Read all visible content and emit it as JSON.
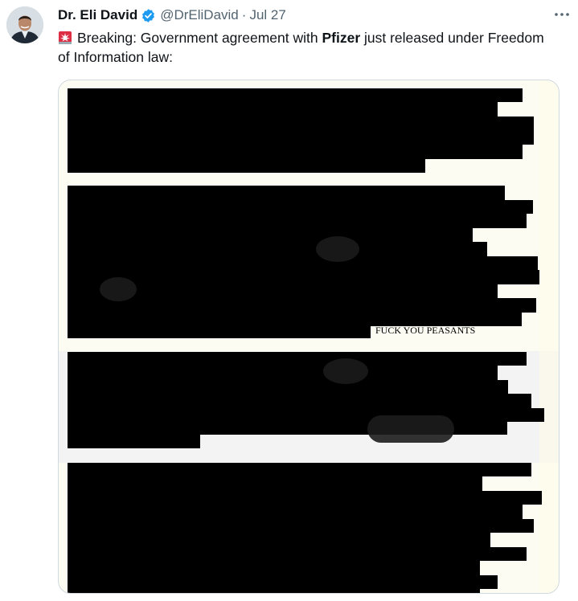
{
  "author": {
    "display_name": "Dr. Eli David",
    "handle": "@DrEliDavid",
    "separator": "·",
    "timestamp": "Jul 27",
    "verified": true
  },
  "tweet": {
    "text_pre": "Breaking: Government agreement with ",
    "text_bold": "Pfizer",
    "text_post": " just released under Freedom of Information law:",
    "emoji": "siren-emoji"
  },
  "media": {
    "document_text": "FUCK YOU PEASANTS"
  },
  "icons": {
    "verified": "verified-badge-icon",
    "more": "more-icon",
    "siren": "siren-emoji"
  },
  "colors": {
    "verified_blue": "#1d9bf0",
    "secondary_text": "#536471",
    "primary_text": "#0f1419",
    "paper": "#fdfcf3",
    "gray_band": "#f3f3f3"
  }
}
